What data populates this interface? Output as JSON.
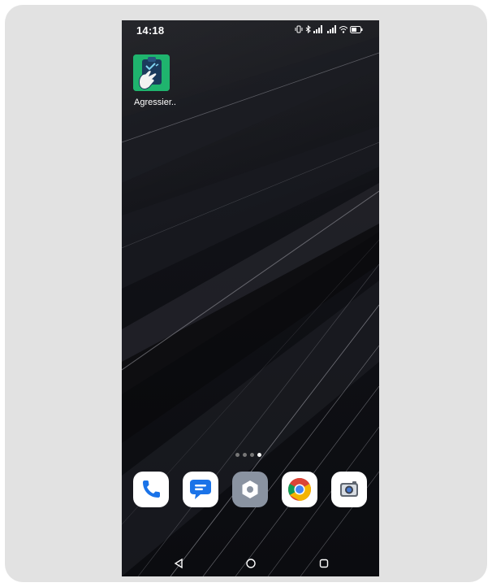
{
  "status_bar": {
    "time": "14:18",
    "icons": [
      "vibrate-icon",
      "bluetooth-icon",
      "signal-icon",
      "signal-icon",
      "wifi-icon",
      "battery-icon"
    ]
  },
  "home_screen": {
    "apps": [
      {
        "label": "Agressier..",
        "icon": "clipboard-hand-app-icon",
        "color": "#1fb46e"
      }
    ],
    "page_indicator": {
      "pages": 4,
      "current": 4
    }
  },
  "dock": {
    "apps": [
      {
        "icon": "phone-icon"
      },
      {
        "icon": "messages-icon"
      },
      {
        "icon": "settings-icon"
      },
      {
        "icon": "chrome-icon"
      },
      {
        "icon": "camera-icon"
      }
    ]
  },
  "nav_bar": {
    "buttons": [
      "back-icon",
      "home-icon",
      "recents-icon"
    ]
  }
}
